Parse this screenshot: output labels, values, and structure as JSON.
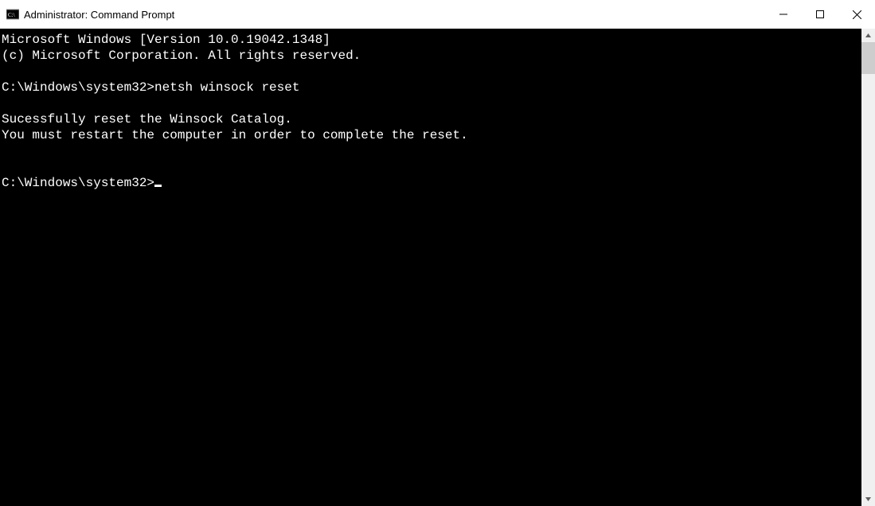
{
  "titlebar": {
    "title": "Administrator: Command Prompt"
  },
  "console": {
    "lines": [
      "Microsoft Windows [Version 10.0.19042.1348]",
      "(c) Microsoft Corporation. All rights reserved.",
      "",
      "C:\\Windows\\system32>netsh winsock reset",
      "",
      "Sucessfully reset the Winsock Catalog.",
      "You must restart the computer in order to complete the reset.",
      "",
      "",
      "C:\\Windows\\system32>"
    ],
    "prompt_index": 9
  }
}
